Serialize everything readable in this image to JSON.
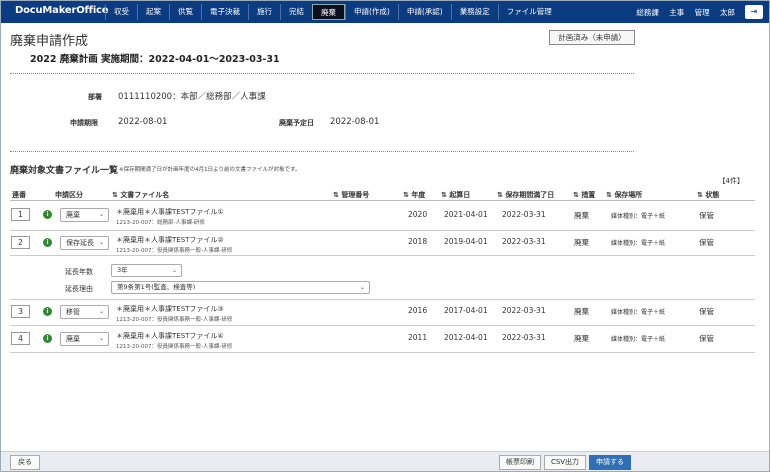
{
  "header": {
    "logo": "DocuMakerOffice",
    "nav": [
      "収受",
      "起案",
      "供覧",
      "電子決裁",
      "施行",
      "完結",
      "廃棄",
      "申請(作成)",
      "申請(承認)",
      "業務設定",
      "ファイル管理"
    ],
    "active_nav": "廃棄",
    "user": {
      "dept": "総務課",
      "role1": "主事",
      "role2": "管理",
      "name": "太郎"
    },
    "logout_icon": "logout-icon"
  },
  "page": {
    "title": "廃棄申請作成",
    "status": "計画済み（未申請）",
    "plan_title": "2022 廃棄計画 実施期間：2022-04-01〜2023-03-31"
  },
  "info": {
    "dept_label": "部署",
    "dept_value": "0111110200：本部／総務部／人事課",
    "apply_label": "申請期限",
    "apply_value": "2022-08-01",
    "disposal_label": "廃棄予定日",
    "disposal_value": "2022-08-01"
  },
  "list": {
    "title": "廃棄対象文書ファイル一覧",
    "note": "※保存期間満了日が計画年度の4月1日より前の文書ファイルが対象です。",
    "count": "【4件】",
    "columns": {
      "no": "連番",
      "type": "申請区分",
      "file": "文書ファイル名",
      "mgmt": "管理番号",
      "year": "年度",
      "start": "起算日",
      "expire": "保存期間満了日",
      "action": "措置",
      "location": "保存場所",
      "state": "状態"
    },
    "rows": [
      {
        "no": "1",
        "type": "廃棄",
        "name": "＊廃棄用＊人事課TESTファイル①",
        "sub": "1213-20-007：総務部-人事課-研修",
        "year": "2020",
        "start": "2021-04-01",
        "expire": "2022-03-31",
        "action": "廃棄",
        "location": "媒体種別：電子＋紙",
        "state": "保管"
      },
      {
        "no": "2",
        "type": "保存延長",
        "name": "＊廃棄用＊人事課TESTファイル②",
        "sub": "1213-20-007：役員関係事務一般-人事課-研修",
        "year": "2018",
        "start": "2019-04-01",
        "expire": "2022-03-31",
        "action": "廃棄",
        "location": "媒体種別：電子＋紙",
        "state": "保管"
      },
      {
        "no": "3",
        "type": "移管",
        "name": "＊廃棄用＊人事課TESTファイル③",
        "sub": "1213-20-007：役員関係事務一般-人事課-研修",
        "year": "2016",
        "start": "2017-04-01",
        "expire": "2022-03-31",
        "action": "廃棄",
        "location": "媒体種別：電子＋紙",
        "state": "保管"
      },
      {
        "no": "4",
        "type": "廃棄",
        "name": "＊廃棄用＊人事課TESTファイル④",
        "sub": "1213-20-007：役員関係事務一般-人事課-研修",
        "year": "2011",
        "start": "2012-04-01",
        "expire": "2022-03-31",
        "action": "廃棄",
        "location": "媒体種別：電子＋紙",
        "state": "保管"
      }
    ],
    "extension": {
      "years_label": "延長年数",
      "years_value": "3年",
      "reason_label": "延長理由",
      "reason_value": "第9条第1号(監査、検査等)"
    }
  },
  "footer": {
    "back": "戻る",
    "print": "帳票印刷",
    "csv": "CSV出力",
    "submit": "申請する"
  }
}
